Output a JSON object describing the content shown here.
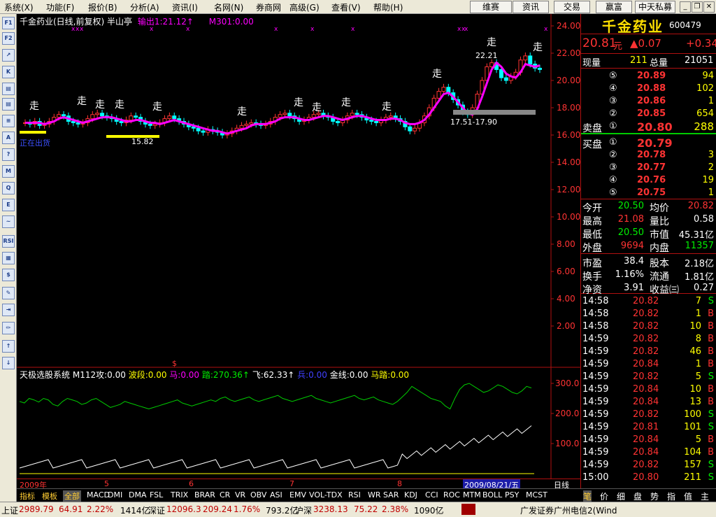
{
  "menu": {
    "items": [
      "系统(X)",
      "功能(F)",
      "报价(B)",
      "分析(A)",
      "资讯(I)",
      "名网(N)",
      "券商网",
      "高级(G)",
      "查看(V)",
      "帮助(H)"
    ],
    "quick": [
      "维赛",
      "资讯",
      "交易",
      "赢富",
      "中天私募"
    ]
  },
  "toolbar": {
    "items": [
      "F1",
      "F2",
      "↗",
      "K",
      "▤",
      "▤",
      "≡",
      "A",
      "?",
      "M",
      "Q",
      "E",
      "~",
      "RSI",
      "▦",
      "$",
      "✎",
      "⇥",
      "✏",
      "↑",
      "↓"
    ]
  },
  "chart": {
    "title": "千金药业(日线,前复权) 半山亭",
    "ma_label": "输出1:21.12↑",
    "m301_label": "M301:0.00",
    "y_labels": [
      "24.00",
      "22.00",
      "20.00",
      "18.00",
      "16.00",
      "14.00",
      "12.00",
      "10.00",
      "8.00",
      "6.00",
      "4.00",
      "2.00"
    ],
    "ind_y_labels": [
      "300.0",
      "200.0",
      "100.0"
    ],
    "zou_label": "走",
    "annot_high": "22.21",
    "annot_low": "15.82",
    "annot_range": "17.51-17.90",
    "annot_blue": "正在出货",
    "dollar_mark": "$",
    "indicator_title": {
      "name": "天极选股系统",
      "m112": "M112攻:0.00",
      "bo": "波段:0.00",
      "ma": "马:0.00",
      "ta": "踏:270.36↑",
      "fei": "飞:62.33↑",
      "bing": "兵:0.00",
      "jin": "金线:0.00",
      "mata": "马踏:0.00"
    }
  },
  "date_axis": {
    "labels": [
      "2009年",
      "5",
      "6",
      "7",
      "8"
    ],
    "current": "2009/08/21/五",
    "period": "日线"
  },
  "tabs": {
    "items": [
      "指标",
      "模板",
      "全部",
      "MACD",
      "DMI",
      "DMA",
      "FSL",
      "TRIX",
      "BRAR",
      "CR",
      "VR",
      "OBV",
      "ASI",
      "EMV",
      "VOL-TDX",
      "RSI",
      "WR",
      "SAR",
      "KDJ",
      "CCI",
      "ROC",
      "MTM",
      "BOLL",
      "PSY",
      "MCST"
    ],
    "active_index": 2
  },
  "quote": {
    "name": "千金药业",
    "code": "600479",
    "price": "20.81",
    "unit": "元",
    "change": "▲0.07",
    "change2": "+0.34",
    "xianliang_label": "现量",
    "xianliang": "211",
    "zongliang_label": "总量",
    "zongliang": "21051",
    "sell": [
      {
        "n": "⑤",
        "p": "20.89",
        "v": "94"
      },
      {
        "n": "④",
        "p": "20.88",
        "v": "102"
      },
      {
        "n": "③",
        "p": "20.86",
        "v": "1"
      },
      {
        "n": "②",
        "p": "20.85",
        "v": "654"
      },
      {
        "n": "①",
        "p": "20.80",
        "v": "288"
      }
    ],
    "sell_label": "卖盘",
    "buy": [
      {
        "n": "①",
        "p": "20.79",
        "v": ""
      },
      {
        "n": "②",
        "p": "20.78",
        "v": "3"
      },
      {
        "n": "③",
        "p": "20.77",
        "v": "2"
      },
      {
        "n": "④",
        "p": "20.76",
        "v": "19"
      },
      {
        "n": "⑤",
        "p": "20.75",
        "v": "1"
      }
    ],
    "buy_label": "买盘",
    "stats": [
      {
        "l1": "今开",
        "v1": "20.50",
        "l2": "均价",
        "v2": "20.82"
      },
      {
        "l1": "最高",
        "v1": "21.08",
        "l2": "量比",
        "v2": "0.58"
      },
      {
        "l1": "最低",
        "v1": "20.50",
        "l2": "市值",
        "v2": "45.31亿"
      },
      {
        "l1": "外盘",
        "v1": "9694",
        "l2": "内盘",
        "v2": "11357"
      }
    ],
    "stats2": [
      {
        "l1": "市盈",
        "v1": "38.4",
        "l2": "股本",
        "v2": "2.18亿"
      },
      {
        "l1": "换手",
        "v1": "1.16%",
        "l2": "流通",
        "v2": "1.81亿"
      },
      {
        "l1": "净资",
        "v1": "3.91",
        "l2": "收益㈢",
        "v2": "0.27"
      }
    ],
    "ticks": [
      {
        "t": "14:58",
        "p": "20.82",
        "v": "7",
        "s": "S"
      },
      {
        "t": "14:58",
        "p": "20.82",
        "v": "1",
        "s": "B"
      },
      {
        "t": "14:58",
        "p": "20.82",
        "v": "10",
        "s": "B"
      },
      {
        "t": "14:59",
        "p": "20.82",
        "v": "8",
        "s": "B"
      },
      {
        "t": "14:59",
        "p": "20.82",
        "v": "46",
        "s": "B"
      },
      {
        "t": "14:59",
        "p": "20.84",
        "v": "1",
        "s": "B"
      },
      {
        "t": "14:59",
        "p": "20.82",
        "v": "5",
        "s": "S"
      },
      {
        "t": "14:59",
        "p": "20.84",
        "v": "10",
        "s": "B"
      },
      {
        "t": "14:59",
        "p": "20.84",
        "v": "13",
        "s": "B"
      },
      {
        "t": "14:59",
        "p": "20.82",
        "v": "100",
        "s": "S"
      },
      {
        "t": "14:59",
        "p": "20.81",
        "v": "101",
        "s": "S"
      },
      {
        "t": "14:59",
        "p": "20.84",
        "v": "5",
        "s": "B"
      },
      {
        "t": "14:59",
        "p": "20.84",
        "v": "104",
        "s": "B"
      },
      {
        "t": "14:59",
        "p": "20.82",
        "v": "157",
        "s": "S"
      },
      {
        "t": "15:00",
        "p": "20.80",
        "v": "211",
        "s": "S"
      }
    ],
    "bottom_tabs": [
      "笔",
      "价",
      "细",
      "盘",
      "势",
      "指",
      "值",
      "主"
    ]
  },
  "status": {
    "sh_label": "上证",
    "sh_val": "2989.79",
    "sh_chg": "64.91",
    "sh_pct": "2.22%",
    "sh_amt": "1414亿",
    "sz_label": "深证",
    "sz_val": "12096.3",
    "sz_chg": "209.24",
    "sz_pct": "1.76%",
    "sz_amt": "793.2亿",
    "hs_label": "沪深",
    "hs_val": "3238.13",
    "hs_chg": "75.22",
    "hs_pct": "2.38%",
    "hs_amt": "1090亿",
    "broker": "广发证券广州电信2(Wind"
  },
  "colors": {
    "up": "#ff3333",
    "down": "#00ffff",
    "ma": "#ff00ff",
    "bg": "#000000",
    "border": "#b01010",
    "yellow": "#ffff00"
  },
  "price_series": [
    16.9,
    16.8,
    17.0,
    16.7,
    16.8,
    17.0,
    17.3,
    17.5,
    17.4,
    17.0,
    16.9,
    16.8,
    16.9,
    17.2,
    17.5,
    17.6,
    17.4,
    17.3,
    17.2,
    17.0,
    16.9,
    17.1,
    17.4,
    17.3,
    17.0,
    16.8,
    16.7,
    16.8,
    16.9,
    17.2,
    17.4,
    17.2,
    17.0,
    16.8,
    16.6,
    16.5,
    16.3,
    16.2,
    16.4,
    16.3,
    16.2,
    16.0,
    16.1,
    16.3,
    16.5,
    16.7,
    16.8,
    16.9,
    16.8,
    16.7,
    16.8,
    17.0,
    17.3,
    17.5,
    17.6,
    17.4,
    17.2,
    17.0,
    17.1,
    17.3,
    17.5,
    17.6,
    17.4,
    17.3,
    17.0,
    16.9,
    17.1,
    17.4,
    17.6,
    17.5,
    17.3,
    17.1,
    17.0,
    16.9,
    17.1,
    17.3,
    17.4,
    17.2,
    17.0,
    16.6,
    16.3,
    16.5,
    16.9,
    17.4,
    18.0,
    18.7,
    19.2,
    19.5,
    19.1,
    18.6,
    18.2,
    17.7,
    17.5,
    18.0,
    19.0,
    20.0,
    21.0,
    21.3,
    20.8,
    20.2,
    20.0,
    20.3,
    20.6,
    21.5,
    21.8,
    21.2,
    20.9,
    20.8
  ],
  "ma_series": [
    16.9,
    16.9,
    16.9,
    16.9,
    16.8,
    16.9,
    17.0,
    17.2,
    17.3,
    17.2,
    17.1,
    17.0,
    16.9,
    17.0,
    17.1,
    17.2,
    17.3,
    17.3,
    17.3,
    17.2,
    17.1,
    17.0,
    17.0,
    17.1,
    17.1,
    17.0,
    16.9,
    16.9,
    16.8,
    16.9,
    17.0,
    17.1,
    17.0,
    16.9,
    16.8,
    16.7,
    16.6,
    16.5,
    16.4,
    16.3,
    16.3,
    16.2,
    16.1,
    16.2,
    16.3,
    16.4,
    16.5,
    16.7,
    16.8,
    16.8,
    16.8,
    16.9,
    17.0,
    17.2,
    17.3,
    17.3,
    17.3,
    17.2,
    17.1,
    17.1,
    17.2,
    17.3,
    17.4,
    17.4,
    17.3,
    17.2,
    17.1,
    17.2,
    17.3,
    17.4,
    17.4,
    17.3,
    17.2,
    17.1,
    17.1,
    17.1,
    17.2,
    17.2,
    17.1,
    16.9,
    16.8,
    16.8,
    16.9,
    17.1,
    17.5,
    18.0,
    18.5,
    19.0,
    19.1,
    18.8,
    18.4,
    18.0,
    17.6,
    17.5,
    17.9,
    18.8,
    19.8,
    20.8,
    21.3,
    21.0,
    20.5,
    20.3,
    20.2,
    20.6,
    21.2,
    21.1,
    21.0,
    21.1
  ],
  "ind_green": [
    240,
    235,
    250,
    245,
    238,
    250,
    245,
    230,
    225,
    240,
    250,
    245,
    240,
    230,
    235,
    245,
    250,
    240,
    230,
    220,
    225,
    230,
    240,
    235,
    230,
    225,
    220,
    215,
    220,
    225,
    230,
    235,
    240,
    245,
    235,
    230,
    225,
    230,
    235,
    240,
    245,
    240,
    250,
    255,
    245,
    240,
    245,
    250,
    255,
    245,
    240,
    245,
    250,
    255,
    260,
    250,
    245,
    240,
    245,
    250,
    255,
    260,
    250,
    245,
    240,
    235,
    240,
    245,
    250,
    255,
    260,
    250,
    245,
    250,
    255,
    245,
    240,
    235,
    230,
    240,
    255,
    270,
    290,
    280,
    270,
    260,
    250,
    245,
    240,
    225,
    215,
    250,
    280,
    295,
    300,
    290,
    280,
    270,
    275,
    285,
    295,
    290,
    280,
    270,
    265,
    275,
    290,
    285
  ]
}
